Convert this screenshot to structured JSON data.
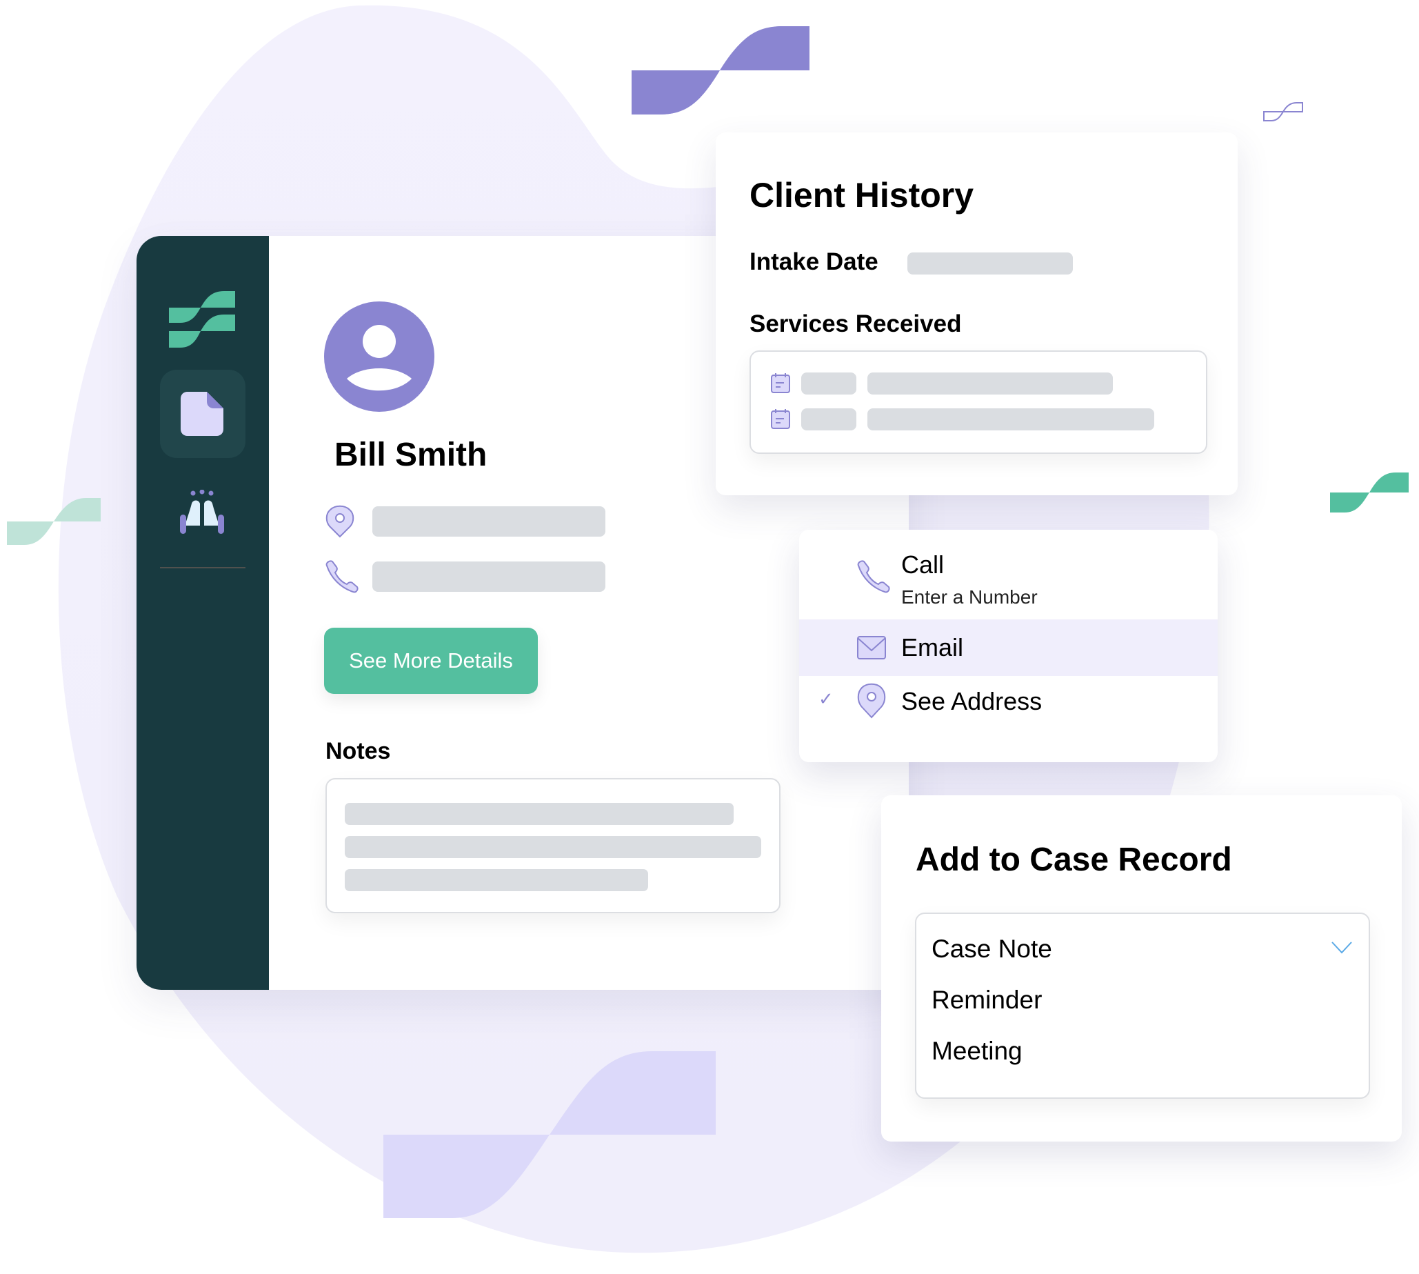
{
  "colors": {
    "sidebar": "#183a40",
    "accent_green": "#54bf9f",
    "accent_purple": "#8a85d1",
    "lavender": "#dcd9fa",
    "skeleton": "#dadde1"
  },
  "sidebar": {
    "logo": "brand-logo-icon",
    "items": [
      {
        "icon": "document-icon",
        "active": true
      },
      {
        "icon": "high-five-hands-icon",
        "active": false
      }
    ]
  },
  "profile": {
    "avatar_icon": "user-avatar-icon",
    "name": "Bill Smith",
    "fields": [
      {
        "icon": "location-pin-icon",
        "value": ""
      },
      {
        "icon": "phone-icon",
        "value": ""
      }
    ],
    "details_button": "See More Details",
    "notes_label": "Notes"
  },
  "client_history": {
    "title": "Client History",
    "intake_label": "Intake Date",
    "services_label": "Services Received",
    "services": [
      {
        "icon": "calendar-icon"
      },
      {
        "icon": "calendar-icon"
      }
    ]
  },
  "contact_menu": {
    "items": [
      {
        "icon": "phone-icon",
        "label": "Call",
        "sublabel": "Enter a Number",
        "highlighted": false,
        "checked": false
      },
      {
        "icon": "mail-icon",
        "label": "Email",
        "highlighted": true,
        "checked": false
      },
      {
        "icon": "location-pin-icon",
        "label": "See Address",
        "highlighted": false,
        "checked": true
      }
    ],
    "check_glyph": "✓"
  },
  "case_record": {
    "title": "Add to Case Record",
    "selected": "Case Note",
    "options": [
      "Case Note",
      "Reminder",
      "Meeting"
    ]
  }
}
